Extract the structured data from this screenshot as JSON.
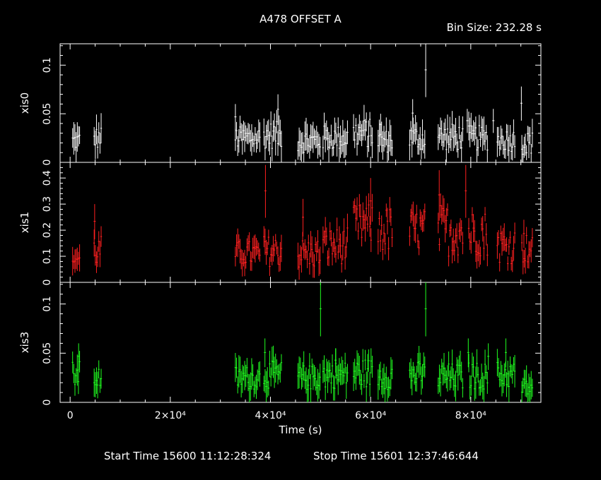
{
  "title": "A478 OFFSET A",
  "bin_size_label": "Bin Size:  232.28  s",
  "footer": {
    "start": "Start Time 15600 11:12:28:324",
    "stop": "Stop Time 15601 12:37:46:644"
  },
  "colors": {
    "background": "#000000",
    "axes": "#ffffff",
    "xis0": "#ffffff",
    "xis1": "#ff2020",
    "xis3": "#20ff20"
  },
  "chart_data": {
    "type": "scatter",
    "title": "A478 OFFSET A",
    "xlabel": "Time (s)",
    "xlim": [
      -2000,
      94000
    ],
    "x_ticks": [
      0,
      20000,
      40000,
      60000,
      80000
    ],
    "x_tick_labels": [
      "0",
      "2×10⁴",
      "4×10⁴",
      "6×10⁴",
      "8×10⁴"
    ],
    "grid": false,
    "panels": [
      {
        "name": "xis0",
        "ylabel": "xis0",
        "color": "#ffffff",
        "ylim": [
          0,
          0.122
        ],
        "y_ticks": [
          0,
          0.05,
          0.1
        ],
        "y_tick_labels": [
          "0",
          "0.05",
          "0.1"
        ],
        "err": 0.012,
        "segments": [
          [
            500,
            2000,
            0.022,
            0.01
          ],
          [
            4800,
            6400,
            0.025,
            0.012
          ],
          [
            33000,
            38000,
            0.025,
            0.012
          ],
          [
            38700,
            42300,
            0.028,
            0.014
          ],
          [
            45500,
            50000,
            0.022,
            0.012
          ],
          [
            50500,
            55600,
            0.025,
            0.013
          ],
          [
            56600,
            60500,
            0.03,
            0.015
          ],
          [
            61500,
            64500,
            0.022,
            0.012
          ],
          [
            67800,
            70900,
            0.025,
            0.013
          ],
          [
            73500,
            78600,
            0.026,
            0.014
          ],
          [
            79600,
            83400,
            0.025,
            0.013
          ],
          [
            85300,
            89000,
            0.023,
            0.012
          ],
          [
            90200,
            92400,
            0.02,
            0.012
          ]
        ],
        "spikes": [
          [
            33000,
            0.06
          ],
          [
            41500,
            0.07
          ],
          [
            62000,
            0.05
          ],
          [
            68400,
            0.065
          ],
          [
            71000,
            0.122
          ],
          [
            79300,
            0.055
          ],
          [
            84500,
            0.055
          ],
          [
            90100,
            0.078
          ]
        ]
      },
      {
        "name": "xis1",
        "ylabel": "xis1",
        "color": "#ff2020",
        "ylim": [
          0,
          0.46
        ],
        "y_ticks": [
          0,
          0.1,
          0.2,
          0.3,
          0.4
        ],
        "y_tick_labels": [
          "0",
          "0.1",
          "0.2",
          "0.3",
          "0.4"
        ],
        "err": 0.04,
        "segments": [
          [
            500,
            2000,
            0.09,
            0.03
          ],
          [
            4800,
            6400,
            0.12,
            0.06
          ],
          [
            33000,
            38000,
            0.11,
            0.05
          ],
          [
            38700,
            42300,
            0.12,
            0.06
          ],
          [
            45500,
            50000,
            0.11,
            0.06
          ],
          [
            50500,
            55600,
            0.14,
            0.07
          ],
          [
            56600,
            60500,
            0.22,
            0.08
          ],
          [
            61500,
            64500,
            0.2,
            0.09
          ],
          [
            67800,
            70900,
            0.2,
            0.08
          ],
          [
            73500,
            78600,
            0.2,
            0.1
          ],
          [
            79600,
            83400,
            0.19,
            0.09
          ],
          [
            85300,
            89000,
            0.14,
            0.07
          ],
          [
            90200,
            92400,
            0.13,
            0.06
          ]
        ],
        "spikes": [
          [
            4900,
            0.3
          ],
          [
            39000,
            0.45
          ],
          [
            46500,
            0.32
          ],
          [
            60000,
            0.4
          ],
          [
            73700,
            0.43
          ],
          [
            79000,
            0.45
          ],
          [
            90600,
            0.24
          ]
        ]
      },
      {
        "name": "xis3",
        "ylabel": "xis3",
        "color": "#20ff20",
        "ylim": [
          0,
          0.122
        ],
        "y_ticks": [
          0,
          0.05,
          0.1
        ],
        "y_tick_labels": [
          "0",
          "0.05",
          "0.1"
        ],
        "err": 0.012,
        "segments": [
          [
            500,
            2000,
            0.028,
            0.014
          ],
          [
            4800,
            6400,
            0.025,
            0.012
          ],
          [
            33000,
            38000,
            0.025,
            0.012
          ],
          [
            38700,
            42300,
            0.028,
            0.014
          ],
          [
            45500,
            50000,
            0.025,
            0.013
          ],
          [
            50500,
            55600,
            0.028,
            0.014
          ],
          [
            56600,
            60500,
            0.03,
            0.015
          ],
          [
            61500,
            64500,
            0.027,
            0.014
          ],
          [
            67800,
            70900,
            0.028,
            0.014
          ],
          [
            73500,
            78600,
            0.026,
            0.014
          ],
          [
            79600,
            83400,
            0.027,
            0.014
          ],
          [
            85300,
            89000,
            0.028,
            0.014
          ],
          [
            90200,
            92400,
            0.015,
            0.01
          ]
        ],
        "spikes": [
          [
            1700,
            0.06
          ],
          [
            38900,
            0.065
          ],
          [
            50000,
            0.122
          ],
          [
            53000,
            0.055
          ],
          [
            71000,
            0.122
          ],
          [
            79500,
            0.065
          ],
          [
            83500,
            0.06
          ],
          [
            87000,
            0.065
          ]
        ]
      }
    ]
  }
}
